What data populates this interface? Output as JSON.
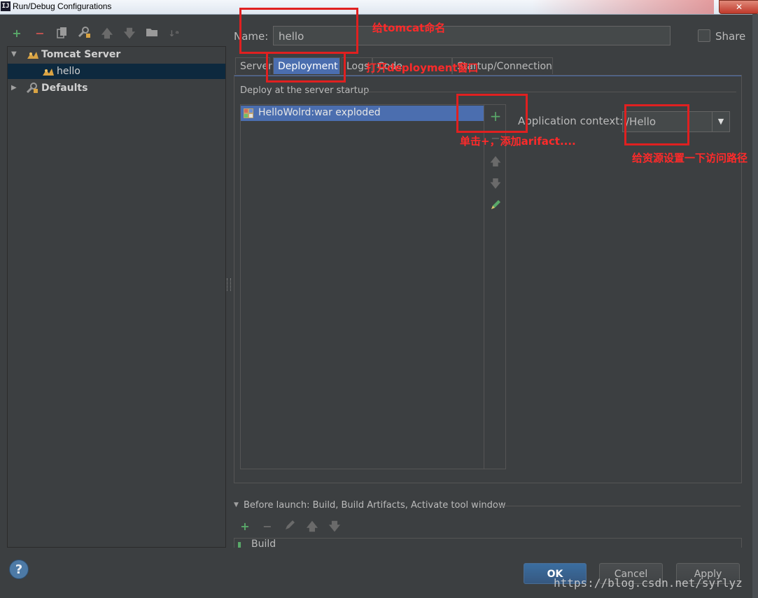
{
  "window": {
    "title": "Run/Debug Configurations",
    "app_icon_text": "IJ",
    "close_label": "✕"
  },
  "toolbar": {
    "icons": [
      "add-icon",
      "remove-icon",
      "copy-icon",
      "edit-defaults-icon",
      "move-up-icon",
      "move-down-icon",
      "folder-icon",
      "sort-icon"
    ]
  },
  "tree": {
    "items": [
      {
        "label": "Tomcat Server",
        "icon": "tomcat-icon",
        "expanded": true
      },
      {
        "label": "hello",
        "icon": "tomcat-icon",
        "selected": true
      },
      {
        "label": "Defaults",
        "icon": "wrench-icon",
        "expanded": false
      }
    ]
  },
  "name_field": {
    "label": "Name:",
    "value": "hello"
  },
  "share": {
    "label": "Share",
    "checked": false
  },
  "tabs": [
    {
      "label": "Server"
    },
    {
      "label": "Deployment",
      "active": true
    },
    {
      "label": "Logs"
    },
    {
      "label": "Code Coverage"
    },
    {
      "label": "Startup/Connection"
    }
  ],
  "deployment": {
    "group_title": "Deploy at the server startup",
    "artifacts": [
      "HelloWolrd:war exploded"
    ],
    "side_buttons": [
      "add-icon",
      "move-up-icon",
      "move-down-icon",
      "edit-icon"
    ],
    "context_label": "Application context:",
    "context_value": "/Hello"
  },
  "before_launch": {
    "label": "Before launch: Build, Build Artifacts, Activate tool window",
    "first_item": "Build",
    "icons": [
      "add-icon",
      "remove-icon",
      "edit-icon",
      "move-up-icon",
      "move-down-icon"
    ]
  },
  "buttons": {
    "ok": "OK",
    "cancel": "Cancel",
    "apply": "Apply",
    "help": "?"
  },
  "annotations": {
    "name_note": "给tomcat命名",
    "tab_note": "打开deployment窗口",
    "add_note": "单击+，添加arifact....",
    "context_note": "给资源设置一下访问路径"
  },
  "watermark": "https://blog.csdn.net/syrlyz",
  "colors": {
    "background": "#3c3f41",
    "selection": "#4b6eaf",
    "tree_selection": "#0d293e",
    "annotation": "#e02020",
    "add_green": "#59a869",
    "remove_red": "#c75450"
  }
}
